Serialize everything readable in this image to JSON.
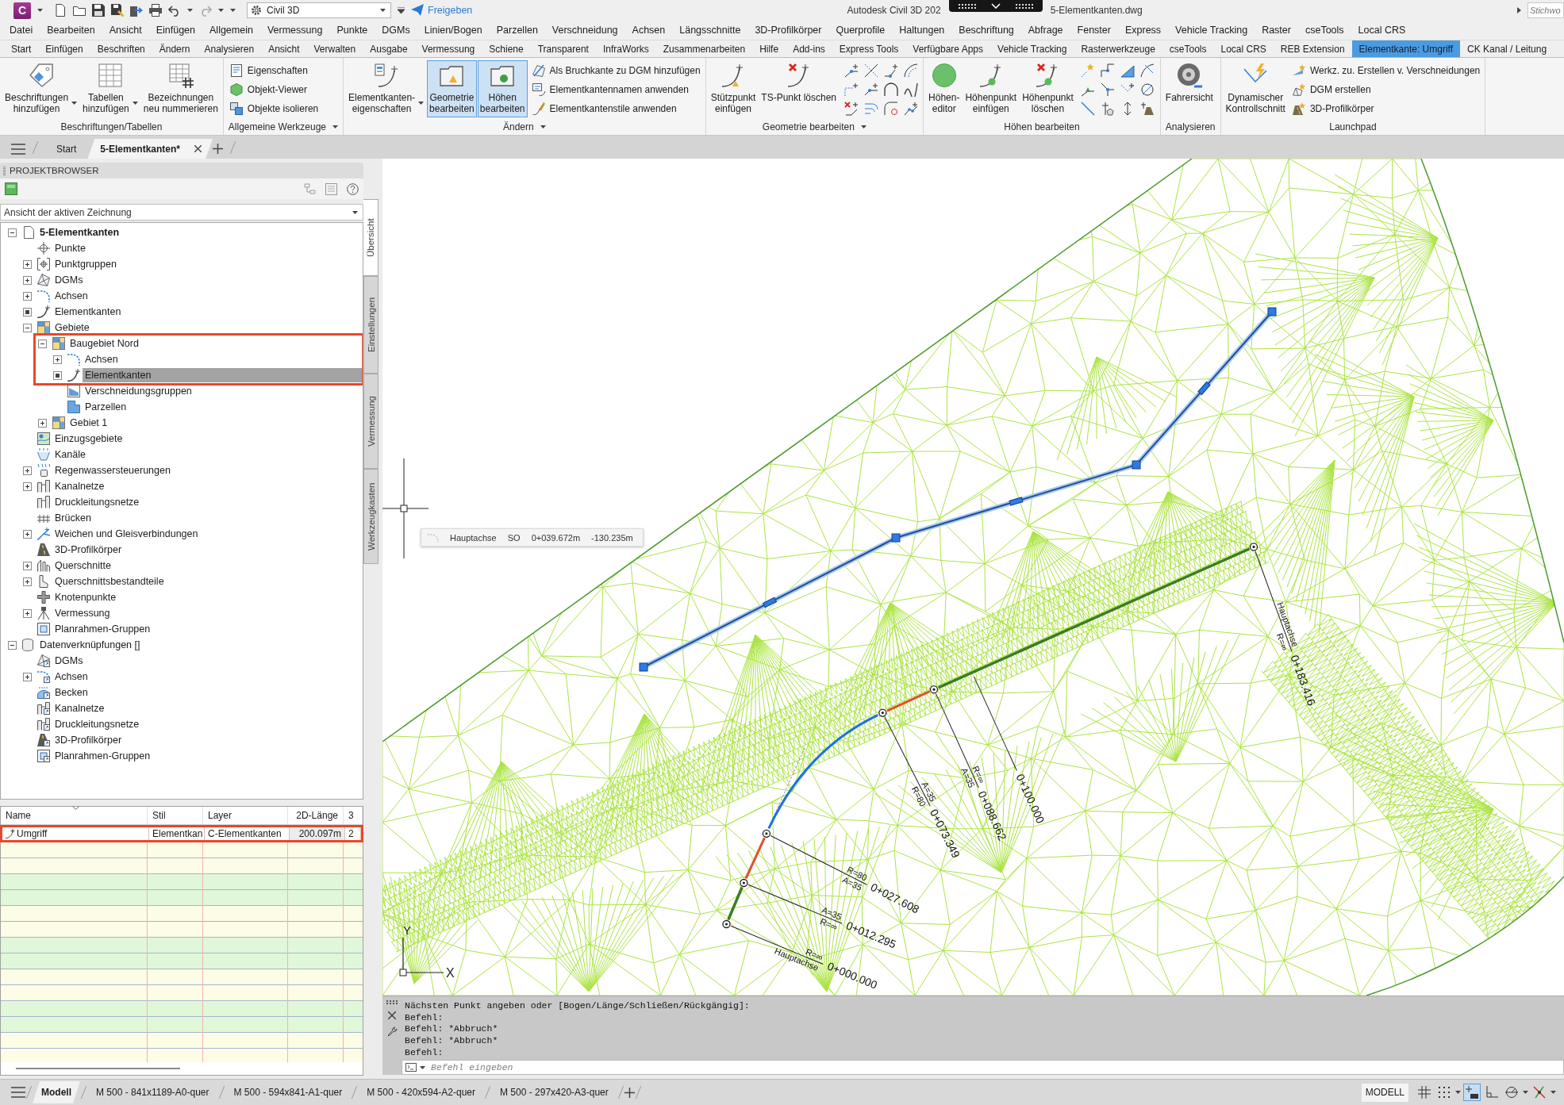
{
  "title_bar": {
    "app_letter": "C",
    "workspace": "Civil 3D",
    "share": "Freigeben",
    "title_parts": [
      "Autodesk Civil 3D 202",
      "5-Elementkanten.dwg"
    ],
    "search": {
      "placeholder": "Stichwo"
    }
  },
  "menu_bar": [
    "Datei",
    "Bearbeiten",
    "Ansicht",
    "Einfügen",
    "Allgemein",
    "Vermessung",
    "Punkte",
    "DGMs",
    "Linien/Bogen",
    "Parzellen",
    "Verschneidung",
    "Achsen",
    "Längsschnitte",
    "3D-Profilkörper",
    "Querprofile",
    "Haltungen",
    "Beschriftung",
    "Abfrage",
    "Fenster",
    "Express",
    "Vehicle Tracking",
    "Raster",
    "cseTools",
    "Local CRS"
  ],
  "ribbon_tabs": [
    {
      "label": "Start",
      "selected": false
    },
    {
      "label": "Einfügen",
      "selected": false
    },
    {
      "label": "Beschriften",
      "selected": false
    },
    {
      "label": "Ändern",
      "selected": false
    },
    {
      "label": "Analysieren",
      "selected": false
    },
    {
      "label": "Ansicht",
      "selected": false
    },
    {
      "label": "Verwalten",
      "selected": false
    },
    {
      "label": "Ausgabe",
      "selected": false
    },
    {
      "label": "Vermessung",
      "selected": false
    },
    {
      "label": "Schiene",
      "selected": false
    },
    {
      "label": "Transparent",
      "selected": false
    },
    {
      "label": "InfraWorks",
      "selected": false
    },
    {
      "label": "Zusammenarbeiten",
      "selected": false
    },
    {
      "label": "Hilfe",
      "selected": false
    },
    {
      "label": "Add-ins",
      "selected": false
    },
    {
      "label": "Express Tools",
      "selected": false
    },
    {
      "label": "Verfügbare Apps",
      "selected": false
    },
    {
      "label": "Vehicle Tracking",
      "selected": false
    },
    {
      "label": "Rasterwerkzeuge",
      "selected": false
    },
    {
      "label": "cseTools",
      "selected": false
    },
    {
      "label": "Local CRS",
      "selected": false
    },
    {
      "label": "REB Extension",
      "selected": false
    },
    {
      "label": "Elementkante: Umgriff",
      "selected": true
    },
    {
      "label": "CK Kanal / Leitung",
      "selected": false
    }
  ],
  "ribbon_panels": [
    {
      "title": "Beschriftungen/Tabellen",
      "dropdown": false,
      "large": [
        {
          "label": "Beschriftungen\nhinzufügen",
          "dropdown": true,
          "active": false
        },
        {
          "label": "Tabellen\nhinzufügen",
          "dropdown": true,
          "active": false
        },
        {
          "label": "Bezeichnungen\nneu nummerieren",
          "dropdown": false,
          "active": false
        }
      ]
    },
    {
      "title": "Allgemeine Werkzeuge",
      "dropdown": true,
      "small": [
        "Eigenschaften",
        "Objekt-Viewer",
        "Objekte isolieren"
      ]
    },
    {
      "title": "Ändern",
      "dropdown": true,
      "large": [
        {
          "label": "Elementkanten-\neigenschaften",
          "dropdown": true,
          "active": false
        },
        {
          "label": "Geometrie\nbearbeiten",
          "dropdown": false,
          "active": true
        },
        {
          "label": "Höhen\nbearbeiten",
          "dropdown": false,
          "active": true
        }
      ],
      "small": [
        "Als Bruchkante zu DGM hinzufügen",
        "Elementkantennamen anwenden",
        "Elementkantenstile anwenden"
      ]
    },
    {
      "title": "Geometrie bearbeiten",
      "dropdown": true,
      "large": [
        {
          "label": "Stützpunkt\neinfügen",
          "dropdown": false,
          "active": false
        },
        {
          "label": "TS-Punkt löschen",
          "dropdown": false,
          "active": false
        }
      ]
    },
    {
      "title": "Höhen bearbeiten",
      "dropdown": false,
      "large": [
        {
          "label": "Höhen-\neditor",
          "dropdown": false,
          "active": false
        },
        {
          "label": "Höhenpunkt\neinfügen",
          "dropdown": false,
          "active": false
        },
        {
          "label": "Höhenpunkt\nlöschen",
          "dropdown": false,
          "active": false
        }
      ]
    },
    {
      "title": "Analysieren",
      "dropdown": false,
      "large": [
        {
          "label": "Fahrersicht",
          "dropdown": false,
          "active": false
        }
      ]
    },
    {
      "title": "Launchpad",
      "dropdown": false,
      "large": [
        {
          "label": "Dynamischer\nKontrollschnitt",
          "dropdown": false,
          "active": false
        }
      ],
      "small": [
        "Werkz. zu. Erstellen v. Verschneidungen",
        "DGM erstellen",
        "3D-Profilkörper"
      ]
    }
  ],
  "document_tabs": [
    {
      "label": "Start",
      "selected": false
    },
    {
      "label": "5-Elementkanten*",
      "selected": true
    }
  ],
  "project_browser": {
    "title": "PROJEKTBROWSER",
    "view": "Ansicht der aktiven Zeichnung",
    "tree": [
      {
        "label": "5-Elementkanten",
        "kind": "drawing",
        "expanded": true,
        "selected": false,
        "framed": false,
        "children": [
          {
            "label": "Punkte",
            "kind": "points",
            "selected": false,
            "framed": false
          },
          {
            "label": "Punktgruppen",
            "kind": "point-groups",
            "expanded": false,
            "selected": false,
            "framed": false
          },
          {
            "label": "DGMs",
            "kind": "surfaces",
            "expanded": false,
            "selected": false,
            "framed": false
          },
          {
            "label": "Achsen",
            "kind": "alignments",
            "expanded": false,
            "selected": false,
            "framed": false
          },
          {
            "label": "Elementkanten",
            "kind": "feature-lines",
            "listed": true,
            "selected": false,
            "framed": false
          },
          {
            "label": "Gebiete",
            "kind": "sites",
            "expanded": true,
            "selected": false,
            "framed": false,
            "children": [
              {
                "label": "Baugebiet Nord",
                "kind": "site",
                "expanded": true,
                "selected": false,
                "framed": true,
                "children": [
                  {
                    "label": "Achsen",
                    "kind": "alignments",
                    "expanded": false,
                    "selected": false,
                    "framed": true
                  },
                  {
                    "label": "Elementkanten",
                    "kind": "feature-lines",
                    "listed": true,
                    "selected": true,
                    "framed": true
                  },
                  {
                    "label": "Verschneidungsgruppen",
                    "kind": "grading-groups",
                    "selected": false,
                    "framed": false
                  },
                  {
                    "label": "Parzellen",
                    "kind": "parcels",
                    "selected": false,
                    "framed": false
                  }
                ]
              },
              {
                "label": "Gebiet 1",
                "kind": "site",
                "expanded": false,
                "selected": false,
                "framed": false
              }
            ]
          },
          {
            "label": "Einzugsgebiete",
            "kind": "catchments",
            "selected": false,
            "framed": false
          },
          {
            "label": "Kanäle",
            "kind": "channels",
            "selected": false,
            "framed": false
          },
          {
            "label": "Regenwassersteuerungen",
            "kind": "storm-controls",
            "expanded": false,
            "selected": false,
            "framed": false
          },
          {
            "label": "Kanalnetze",
            "kind": "pipe-networks",
            "expanded": false,
            "selected": false,
            "framed": false
          },
          {
            "label": "Druckleitungsnetze",
            "kind": "pressure-networks",
            "selected": false,
            "framed": false
          },
          {
            "label": "Brücken",
            "kind": "bridges",
            "selected": false,
            "framed": false
          },
          {
            "label": "Weichen und Gleisverbindungen",
            "kind": "turnouts",
            "expanded": false,
            "selected": false,
            "framed": false
          },
          {
            "label": "3D-Profilkörper",
            "kind": "corridors",
            "selected": false,
            "framed": false
          },
          {
            "label": "Querschnitte",
            "kind": "assemblies",
            "expanded": false,
            "selected": false,
            "framed": false
          },
          {
            "label": "Querschnittsbestandteile",
            "kind": "subassemblies",
            "expanded": false,
            "selected": false,
            "framed": false
          },
          {
            "label": "Knotenpunkte",
            "kind": "intersections",
            "selected": false,
            "framed": false
          },
          {
            "label": "Vermessung",
            "kind": "survey",
            "expanded": false,
            "selected": false,
            "framed": false
          },
          {
            "label": "Planrahmen-Gruppen",
            "kind": "view-frames",
            "selected": false,
            "framed": false
          }
        ]
      },
      {
        "label": "Datenverknüpfungen []",
        "kind": "data-links",
        "expanded": true,
        "selected": false,
        "framed": false,
        "children": [
          {
            "label": "DGMs",
            "kind": "surfaces",
            "selected": false,
            "framed": false
          },
          {
            "label": "Achsen",
            "kind": "alignments",
            "expanded": false,
            "selected": false,
            "framed": false
          },
          {
            "label": "Becken",
            "kind": "ponds",
            "selected": false,
            "framed": false
          },
          {
            "label": "Kanalnetze",
            "kind": "pipe-networks",
            "selected": false,
            "framed": false
          },
          {
            "label": "Druckleitungsnetze",
            "kind": "pressure-networks",
            "selected": false,
            "framed": false
          },
          {
            "label": "3D-Profilkörper",
            "kind": "corridors",
            "selected": false,
            "framed": false
          },
          {
            "label": "Planrahmen-Gruppen",
            "kind": "view-frames",
            "selected": false,
            "framed": false
          }
        ]
      }
    ],
    "side_tabs": [
      {
        "label": "Übersicht",
        "selected": true
      },
      {
        "label": "Einstellungen",
        "selected": false
      },
      {
        "label": "Vermessung",
        "selected": false
      },
      {
        "label": "Werkzeugkasten",
        "selected": false
      }
    ]
  },
  "item_table": {
    "columns": [
      "Name",
      "Stil",
      "Layer",
      "2D-Länge",
      "3"
    ],
    "rows": [
      {
        "cells": [
          "Umgriff",
          "Elementkan",
          "C-Elementkanten",
          "200.097m",
          "2"
        ],
        "framed": true
      }
    ]
  },
  "drawing": {
    "tooltip": [
      "Hauptachse",
      "SO",
      "0+039.672m",
      "-130.235m"
    ],
    "stations": [
      {
        "station": "0+000.000",
        "above": "R=∞",
        "below": "Hauptachse"
      },
      {
        "station": "0+012.295",
        "above": "A=35",
        "below": "R=∞"
      },
      {
        "station": "0+027.608",
        "above": "R=80",
        "below": "A=35"
      },
      {
        "station": "0+073.349",
        "above": "A=35",
        "below": "R=80"
      },
      {
        "station": "0+088.662",
        "above": "R=∞",
        "below": "A=35"
      },
      {
        "station": "0+100.000"
      },
      {
        "station": "0+183.416",
        "above": "Hauptachse",
        "below": "R=∞"
      }
    ],
    "ucs": {
      "x": "X",
      "y": "Y"
    }
  },
  "command_line": {
    "history": [
      "Nächsten Punkt angeben oder [Bogen/Länge/Schließen/Rückgängig]:",
      "Befehl:",
      "Befehl: *Abbruch*",
      "Befehl: *Abbruch*",
      "Befehl:"
    ],
    "placeholder": "Befehl eingeben"
  },
  "status_bar": {
    "layout_tabs": [
      {
        "label": "Modell",
        "selected": true
      },
      {
        "label": "M 500 - 841x1189-A0-quer",
        "selected": false
      },
      {
        "label": "M 500 - 594x841-A1-quer",
        "selected": false
      },
      {
        "label": "M 500 - 420x594-A2-quer",
        "selected": false
      },
      {
        "label": "M 500 - 297x420-A3-quer",
        "selected": false
      }
    ],
    "space": "MODELL",
    "toggles": [
      {
        "on": false
      },
      {
        "on": false
      },
      {
        "on": true
      },
      {
        "on": false
      },
      {
        "on": false
      },
      {
        "on": false
      }
    ]
  }
}
